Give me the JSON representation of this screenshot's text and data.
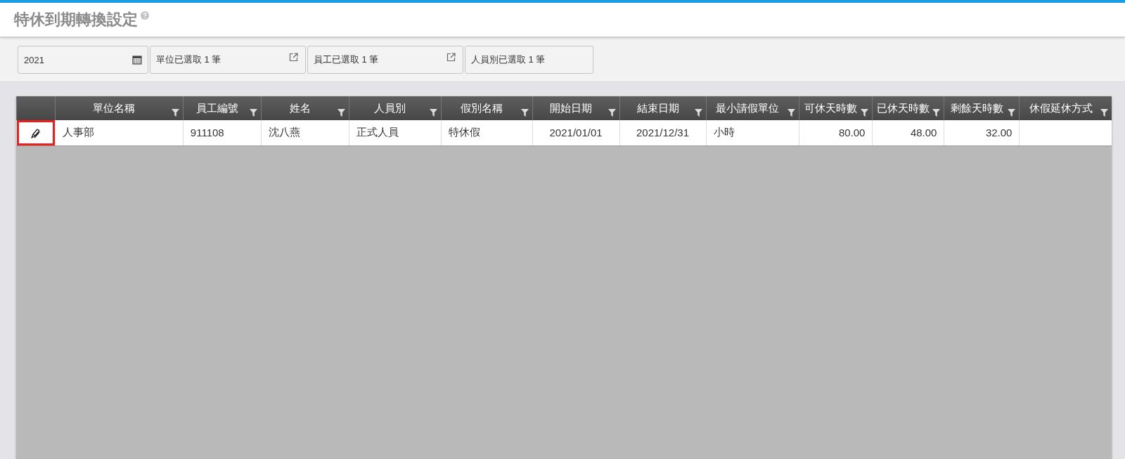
{
  "page": {
    "title": "特休到期轉換設定"
  },
  "filters": [
    {
      "kind": "date",
      "value": "2021"
    },
    {
      "kind": "picker",
      "value": "單位已選取 1 筆"
    },
    {
      "kind": "picker",
      "value": "員工已選取 1 筆"
    },
    {
      "kind": "plain",
      "value": "人員別已選取 1 筆"
    }
  ],
  "table": {
    "columns": [
      {
        "label": "單位名稱",
        "kind": "text"
      },
      {
        "label": "員工編號",
        "kind": "text"
      },
      {
        "label": "姓名",
        "kind": "text"
      },
      {
        "label": "人員別",
        "kind": "text"
      },
      {
        "label": "假別名稱",
        "kind": "text"
      },
      {
        "label": "開始日期",
        "kind": "date"
      },
      {
        "label": "結束日期",
        "kind": "date"
      },
      {
        "label": "最小請假單位",
        "kind": "text"
      },
      {
        "label": "可休天時數",
        "kind": "number"
      },
      {
        "label": "已休天時數",
        "kind": "number"
      },
      {
        "label": "剩餘天時數",
        "kind": "number"
      },
      {
        "label": "休假延休方式",
        "kind": "text"
      }
    ],
    "rows": [
      {
        "edit_focused": true,
        "cells": [
          "人事部",
          "911108",
          "沈八燕",
          "正式人員",
          "特休假",
          "2021/01/01",
          "2021/12/31",
          "小時",
          "80.00",
          "48.00",
          "32.00",
          ""
        ]
      }
    ]
  }
}
